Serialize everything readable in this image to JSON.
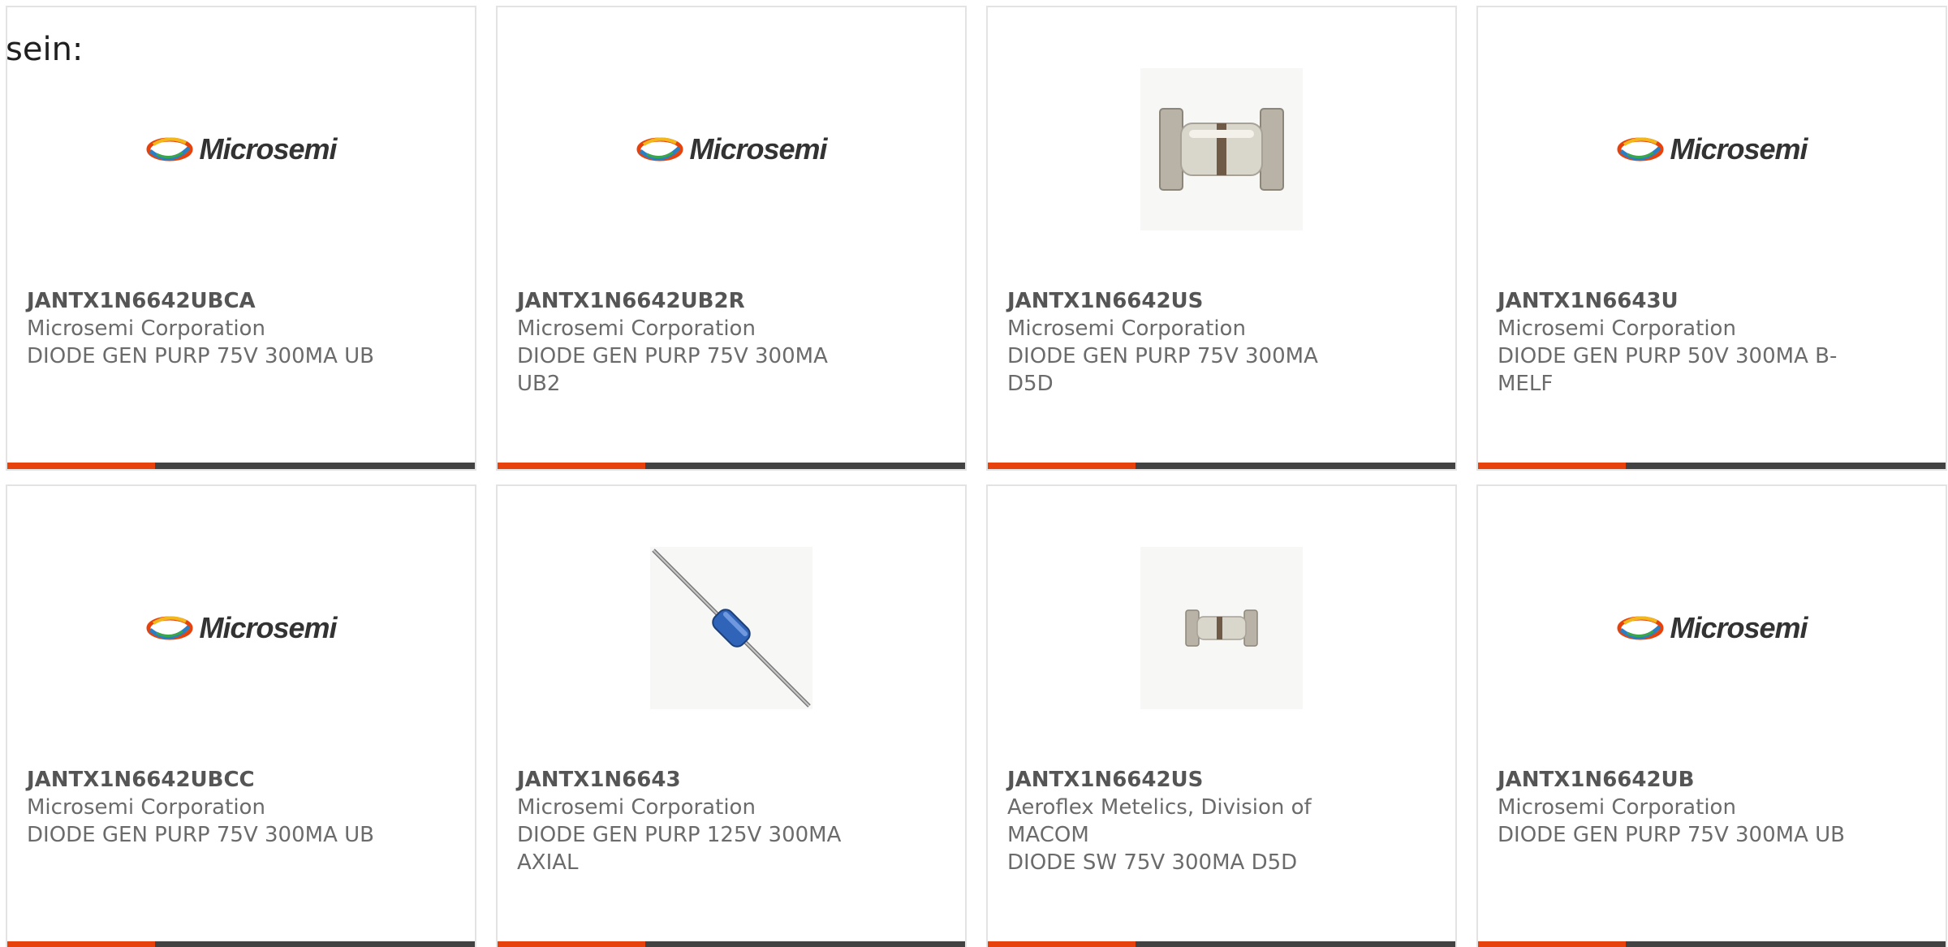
{
  "intro_text": "sein:",
  "logo": {
    "text": "Microsemi",
    "icon": "microsemi-logo-icon"
  },
  "colors": {
    "accent": "#e8420c",
    "bar": "#424242",
    "text": "#6b6b6b",
    "border": "#e3e3e3"
  },
  "products": [
    {
      "part": "JANTX1N6642UBCA",
      "manufacturer": "Microsemi Corporation",
      "desc_1": "DIODE GEN PURP 75V 300MA UB",
      "desc_2": "",
      "image": "microsemi-logo"
    },
    {
      "part": "JANTX1N6642UB2R",
      "manufacturer": "Microsemi Corporation",
      "desc_1": "DIODE GEN PURP 75V 300MA",
      "desc_2": "UB2",
      "image": "microsemi-logo"
    },
    {
      "part": "JANTX1N6642US",
      "manufacturer": "Microsemi Corporation",
      "desc_1": "DIODE GEN PURP 75V 300MA",
      "desc_2": "D5D",
      "image": "d5d-diode-photo"
    },
    {
      "part": "JANTX1N6643U",
      "manufacturer": "Microsemi Corporation",
      "desc_1": "DIODE GEN PURP 50V 300MA B-",
      "desc_2": "MELF",
      "image": "microsemi-logo"
    },
    {
      "part": "JANTX1N6642UBCC",
      "manufacturer": "Microsemi Corporation",
      "desc_1": "DIODE GEN PURP 75V 300MA UB",
      "desc_2": "",
      "image": "microsemi-logo"
    },
    {
      "part": "JANTX1N6643",
      "manufacturer": "Microsemi Corporation",
      "desc_1": "DIODE GEN PURP 125V 300MA",
      "desc_2": "AXIAL",
      "image": "axial-diode-photo"
    },
    {
      "part": "JANTX1N6642US",
      "manufacturer": "Aeroflex Metelics, Division of",
      "manufacturer_2": "MACOM",
      "desc_1": "DIODE SW 75V 300MA D5D",
      "desc_2": "",
      "image": "d5d-diode-small-photo"
    },
    {
      "part": "JANTX1N6642UB",
      "manufacturer": "Microsemi Corporation",
      "desc_1": "DIODE GEN PURP 75V 300MA UB",
      "desc_2": "",
      "image": "microsemi-logo"
    }
  ]
}
